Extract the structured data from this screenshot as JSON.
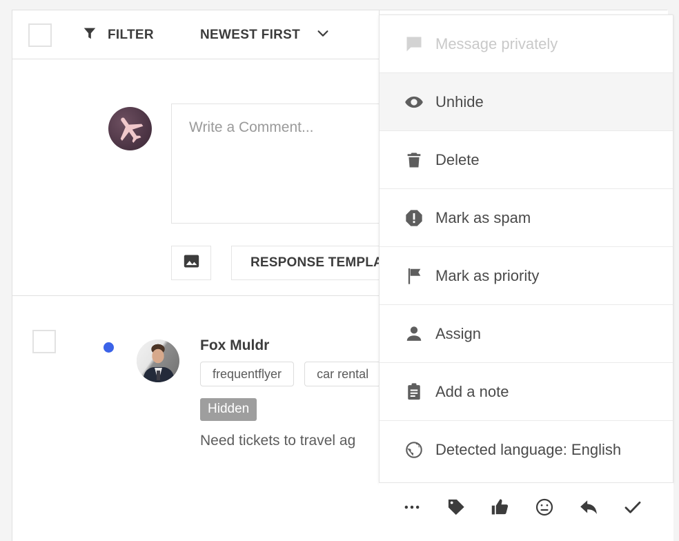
{
  "toolbar": {
    "select_all_checkbox": "",
    "filter_icon": "filter-icon",
    "filter_label": "FILTER",
    "sort_label": "NEWEST FIRST",
    "sort_caret_icon": "chevron-down-icon"
  },
  "compose": {
    "avatar_icon": "airplane-avatar",
    "comment_placeholder": "Write a Comment...",
    "comment_value": "",
    "image_button_icon": "image-icon",
    "response_template_label": "RESPONSE TEMPLATE"
  },
  "conversation": {
    "checkbox": "",
    "unread_dot_color": "#3b63e8",
    "avatar_icon": "user-photo-avatar",
    "name": "Fox Muldr",
    "tags": [
      "frequentflyer",
      "car rental"
    ],
    "status_badge": "Hidden",
    "snippet": "Need tickets to travel ag"
  },
  "menu": {
    "items": [
      {
        "icon": "message-icon",
        "label": "Message privately",
        "state": "disabled"
      },
      {
        "icon": "eye-icon",
        "label": "Unhide",
        "state": "highlight"
      },
      {
        "icon": "trash-icon",
        "label": "Delete",
        "state": "normal"
      },
      {
        "icon": "alert-icon",
        "label": "Mark as spam",
        "state": "normal"
      },
      {
        "icon": "flag-icon",
        "label": "Mark as priority",
        "state": "normal"
      },
      {
        "icon": "person-icon",
        "label": "Assign",
        "state": "normal"
      },
      {
        "icon": "clipboard-icon",
        "label": "Add a note",
        "state": "normal"
      },
      {
        "icon": "globe-icon",
        "label": "Detected language: English",
        "state": "normal"
      }
    ]
  },
  "action_bar": {
    "buttons": [
      {
        "icon": "more-horizontal-icon",
        "name": "more-button"
      },
      {
        "icon": "tag-icon",
        "name": "tag-button"
      },
      {
        "icon": "thumbs-up-icon",
        "name": "like-button"
      },
      {
        "icon": "neutral-face-icon",
        "name": "sentiment-button"
      },
      {
        "icon": "reply-icon",
        "name": "reply-button"
      },
      {
        "icon": "check-icon",
        "name": "resolve-button"
      }
    ]
  },
  "colors": {
    "accent_blue": "#3b63e8",
    "badge_gray": "#9e9e9e",
    "text_dark": "#3c3c3c",
    "text_muted": "#c9c9c9",
    "highlight_bg": "#f5f5f5"
  }
}
